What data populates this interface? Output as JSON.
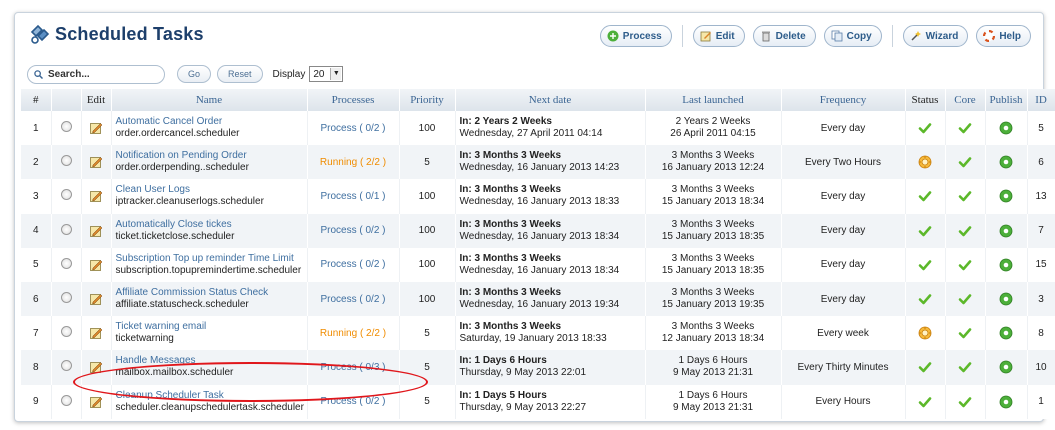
{
  "header": {
    "title": "Scheduled Tasks"
  },
  "toolbar": {
    "process": "Process",
    "edit": "Edit",
    "delete": "Delete",
    "copy": "Copy",
    "wizard": "Wizard",
    "help": "Help"
  },
  "filter": {
    "search_placeholder": "Search...",
    "go": "Go",
    "reset": "Reset",
    "display_label": "Display",
    "display_value": "20"
  },
  "columns": {
    "num": "#",
    "edit": "Edit",
    "name": "Name",
    "processes": "Processes",
    "priority": "Priority",
    "next": "Next date",
    "last": "Last launched",
    "frequency": "Frequency",
    "status": "Status",
    "core": "Core",
    "publish": "Publish",
    "id": "ID"
  },
  "colors": {
    "accent": "#3f6fa0",
    "running": "#f08c00",
    "check": "#5cb82a",
    "publish": "#4caf3a",
    "annotation": "#e0161b"
  },
  "rows": [
    {
      "num": "1",
      "name": "Automatic Cancel Order",
      "task": "order.ordercancel.scheduler",
      "process": "Process ( 0/2 )",
      "running": false,
      "priority": "100",
      "next_in": "In: 2 Years 2 Weeks",
      "next_date": "Wednesday, 27 April 2011 04:14",
      "last_ago": "2 Years 2 Weeks",
      "last_date": "26 April 2011 04:15",
      "frequency": "Every day",
      "status": "ok",
      "id": "5"
    },
    {
      "num": "2",
      "name": "Notification on Pending Order",
      "task": "order.orderpending..scheduler",
      "process": "Running ( 2/2 )",
      "running": true,
      "priority": "5",
      "next_in": "In: 3 Months 3 Weeks",
      "next_date": "Wednesday, 16 January 2013 14:23",
      "last_ago": "3 Months 3 Weeks",
      "last_date": "16 January 2013 12:24",
      "frequency": "Every Two Hours",
      "status": "running",
      "id": "6"
    },
    {
      "num": "3",
      "name": "Clean User Logs",
      "task": "iptracker.cleanuserlogs.scheduler",
      "process": "Process ( 0/1 )",
      "running": false,
      "priority": "100",
      "next_in": "In: 3 Months 3 Weeks",
      "next_date": "Wednesday, 16 January 2013 18:33",
      "last_ago": "3 Months 3 Weeks",
      "last_date": "15 January 2013 18:34",
      "frequency": "Every day",
      "status": "ok",
      "id": "13"
    },
    {
      "num": "4",
      "name": "Automatically Close tickes",
      "task": "ticket.ticketclose.scheduler",
      "process": "Process ( 0/2 )",
      "running": false,
      "priority": "100",
      "next_in": "In: 3 Months 3 Weeks",
      "next_date": "Wednesday, 16 January 2013 18:34",
      "last_ago": "3 Months 3 Weeks",
      "last_date": "15 January 2013 18:35",
      "frequency": "Every day",
      "status": "ok",
      "id": "7"
    },
    {
      "num": "5",
      "name": "Subscription Top up reminder Time Limit",
      "task": "subscription.topupremindertime.scheduler",
      "process": "Process ( 0/2 )",
      "running": false,
      "priority": "100",
      "next_in": "In: 3 Months 3 Weeks",
      "next_date": "Wednesday, 16 January 2013 18:34",
      "last_ago": "3 Months 3 Weeks",
      "last_date": "15 January 2013 18:35",
      "frequency": "Every day",
      "status": "ok",
      "id": "15"
    },
    {
      "num": "6",
      "name": "Affiliate Commission Status Check",
      "task": "affiliate.statuscheck.scheduler",
      "process": "Process ( 0/2 )",
      "running": false,
      "priority": "100",
      "next_in": "In: 3 Months 3 Weeks",
      "next_date": "Wednesday, 16 January 2013 19:34",
      "last_ago": "3 Months 3 Weeks",
      "last_date": "15 January 2013 19:35",
      "frequency": "Every day",
      "status": "ok",
      "id": "3"
    },
    {
      "num": "7",
      "name": "Ticket warning email",
      "task": "ticketwarning",
      "process": "Running ( 2/2 )",
      "running": true,
      "priority": "5",
      "next_in": "In: 3 Months 3 Weeks",
      "next_date": "Saturday, 19 January 2013 18:33",
      "last_ago": "3 Months 3 Weeks",
      "last_date": "12 January 2013 18:34",
      "frequency": "Every week",
      "status": "running",
      "id": "8"
    },
    {
      "num": "8",
      "name": "Handle Messages",
      "task": "mailbox.mailbox.scheduler",
      "process": "Process ( 0/3 )",
      "running": false,
      "priority": "5",
      "next_in": "In: 1 Days 6 Hours",
      "next_date": "Thursday, 9 May 2013 22:01",
      "last_ago": "1 Days 6 Hours",
      "last_date": "9 May 2013 21:31",
      "frequency": "Every Thirty Minutes",
      "status": "ok",
      "id": "10"
    },
    {
      "num": "9",
      "name": "Cleanup Scheduler Task",
      "task": "scheduler.cleanupschedulertask.scheduler",
      "process": "Process ( 0/2 )",
      "running": false,
      "priority": "5",
      "next_in": "In: 1 Days 5 Hours",
      "next_date": "Thursday, 9 May 2013 22:27",
      "last_ago": "1 Days 6 Hours",
      "last_date": "9 May 2013 21:31",
      "frequency": "Every Hours",
      "status": "ok",
      "id": "1"
    }
  ]
}
